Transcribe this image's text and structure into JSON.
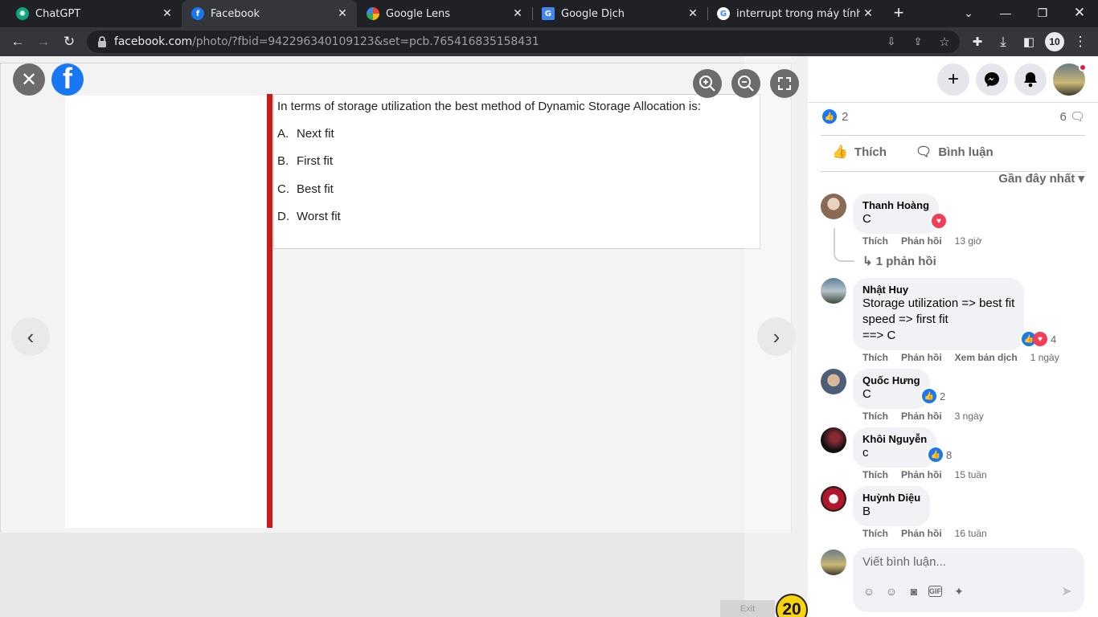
{
  "tabs": [
    {
      "title": "ChatGPT",
      "favicon": "chatgpt-icon",
      "color": "#10a37f"
    },
    {
      "title": "Facebook",
      "favicon": "facebook-icon",
      "color": "#1877f2",
      "active": true
    },
    {
      "title": "Google Lens",
      "favicon": "google-lens-icon",
      "color": "#4285f4"
    },
    {
      "title": "Google Dịch",
      "favicon": "google-translate-icon",
      "color": "#4285f4"
    },
    {
      "title": "interrupt trong máy tính la gì",
      "favicon": "google-icon",
      "color": "#ffffff"
    }
  ],
  "address": {
    "host": "facebook.com",
    "path": "/photo/?fbid=942296340109123&set=pcb.765416835158431"
  },
  "toolbar": {
    "profile_badge": "10"
  },
  "photo": {
    "question": "In terms of storage utilization the best method of Dynamic Storage Allocation is:",
    "options": [
      {
        "letter": "A.",
        "text": "Next fit"
      },
      {
        "letter": "B.",
        "text": "First fit"
      },
      {
        "letter": "C.",
        "text": "Best fit"
      },
      {
        "letter": "D.",
        "text": "Worst fit"
      }
    ],
    "exit_label": "Exit",
    "badge_number": "20"
  },
  "post": {
    "like_count": "2",
    "comment_count": "6",
    "like_label": "Thích",
    "comment_label": "Bình luận",
    "sort_label": "Gần đây nhất"
  },
  "comments": [
    {
      "name": "Thanh Hoàng",
      "text": "C",
      "like": "Thích",
      "reply": "Phản hồi",
      "time": "13 giờ",
      "reaction_count": ""
    },
    {
      "name": "Nhật Huy",
      "text": "Storage utilization => best fit\nspeed => first fit\n==> C",
      "like": "Thích",
      "reply": "Phản hồi",
      "translate": "Xem bản dịch",
      "time": "1 ngày",
      "reaction_count": "4"
    },
    {
      "name": "Quốc Hưng",
      "text": "C",
      "like": "Thích",
      "reply": "Phản hồi",
      "time": "3 ngày",
      "reaction_count": "2"
    },
    {
      "name": "Khôi Nguyễn",
      "text": "c",
      "like": "Thích",
      "reply": "Phản hồi",
      "time": "15 tuần",
      "reaction_count": "8"
    },
    {
      "name": "Huỳnh Diệu",
      "text": "B",
      "like": "Thích",
      "reply": "Phản hồi",
      "time": "16 tuần",
      "reaction_count": ""
    }
  ],
  "replies_link": "1 phản hồi",
  "composer": {
    "placeholder": "Viết bình luận..."
  }
}
